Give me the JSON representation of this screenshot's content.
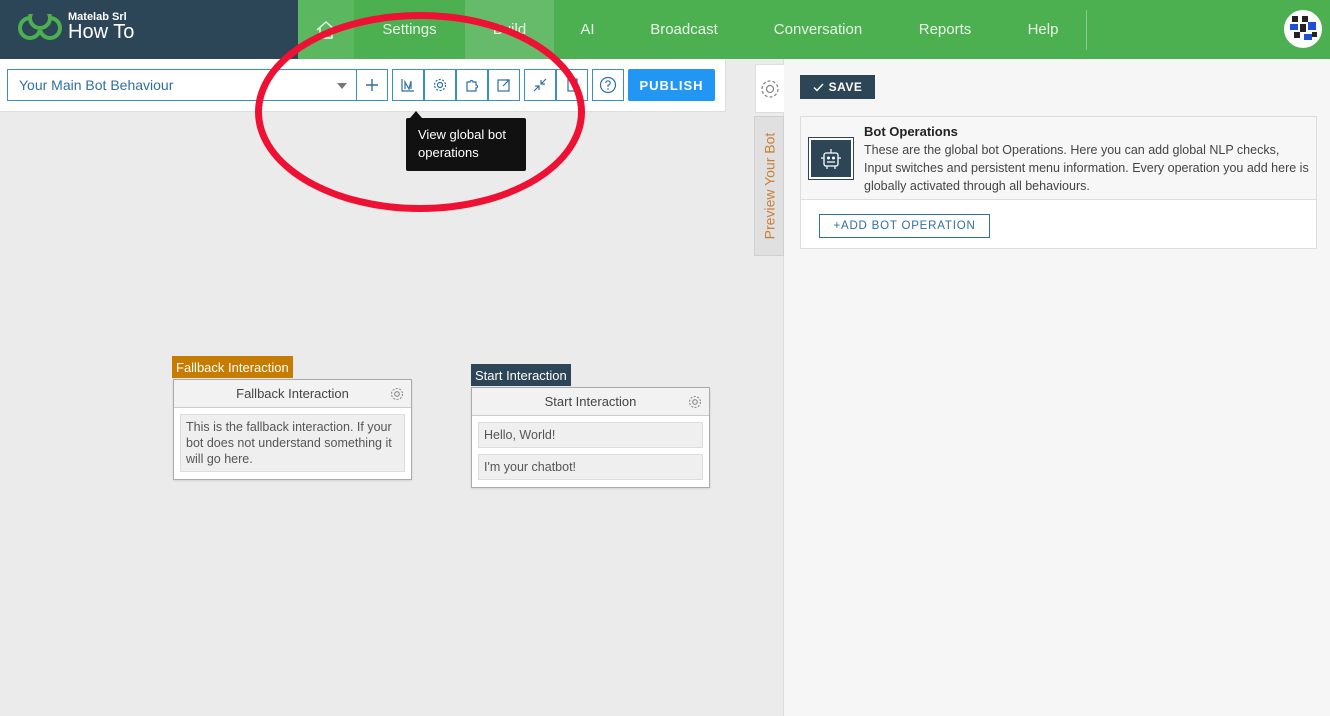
{
  "brand": {
    "org": "Matelab Srl",
    "app": "How To"
  },
  "nav": {
    "settings": "Settings",
    "build": "Build",
    "ai": "AI",
    "broadcast": "Broadcast",
    "conversation": "Conversation",
    "reports": "Reports",
    "help": "Help"
  },
  "toolbar": {
    "behaviour_selected": "Your Main Bot Behaviour",
    "publish": "PUBLISH",
    "tooltip": "View global bot operations"
  },
  "canvas": {
    "fallback": {
      "tag": "Fallback Interaction",
      "title": "Fallback Interaction",
      "messages": [
        "This is the fallback interaction. If your bot does not understand something it will go here."
      ]
    },
    "start": {
      "tag": "Start Interaction",
      "title": "Start Interaction",
      "messages": [
        "Hello, World!",
        "I'm your chatbot!"
      ]
    }
  },
  "sidebar": {
    "preview_tab": "Preview Your Bot",
    "save": "SAVE",
    "ops_title": "Bot Operations",
    "ops_description": "These are the global bot Operations. Here you can add global NLP checks, Input switches and persistent menu information. Every operation you add here is globally activated through all behaviours.",
    "add_op": "ADD BOT OPERATION"
  },
  "colors": {
    "nav_green": "#4caf50",
    "brand_dark": "#2c4557",
    "accent_blue": "#2196f3",
    "fallback_tag": "#c67c00",
    "start_tag": "#2c4557",
    "highlight_red": "#ee1133"
  }
}
